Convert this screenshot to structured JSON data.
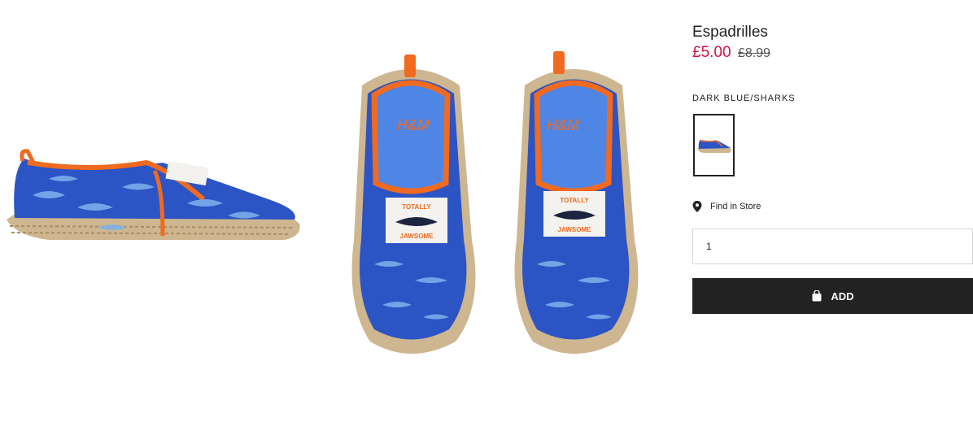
{
  "product": {
    "title": "Espadrilles",
    "price_current": "£5.00",
    "price_original": "£8.99",
    "color_name": "DARK BLUE/SHARKS",
    "find_in_store": "Find in Store",
    "quantity_value": "1",
    "add_label": "ADD",
    "patch_line1": "TOTALLY",
    "patch_line2": "JAWSOME",
    "brand_print": "H&M"
  },
  "colors": {
    "sale_price": "#d01345",
    "button_bg": "#222222",
    "canvas_blue": "#2c54c4",
    "trim_orange": "#f06a1f",
    "jute": "#cdb690"
  },
  "icons": {
    "location": "location-pin-icon",
    "bag": "shopping-bag-icon"
  }
}
